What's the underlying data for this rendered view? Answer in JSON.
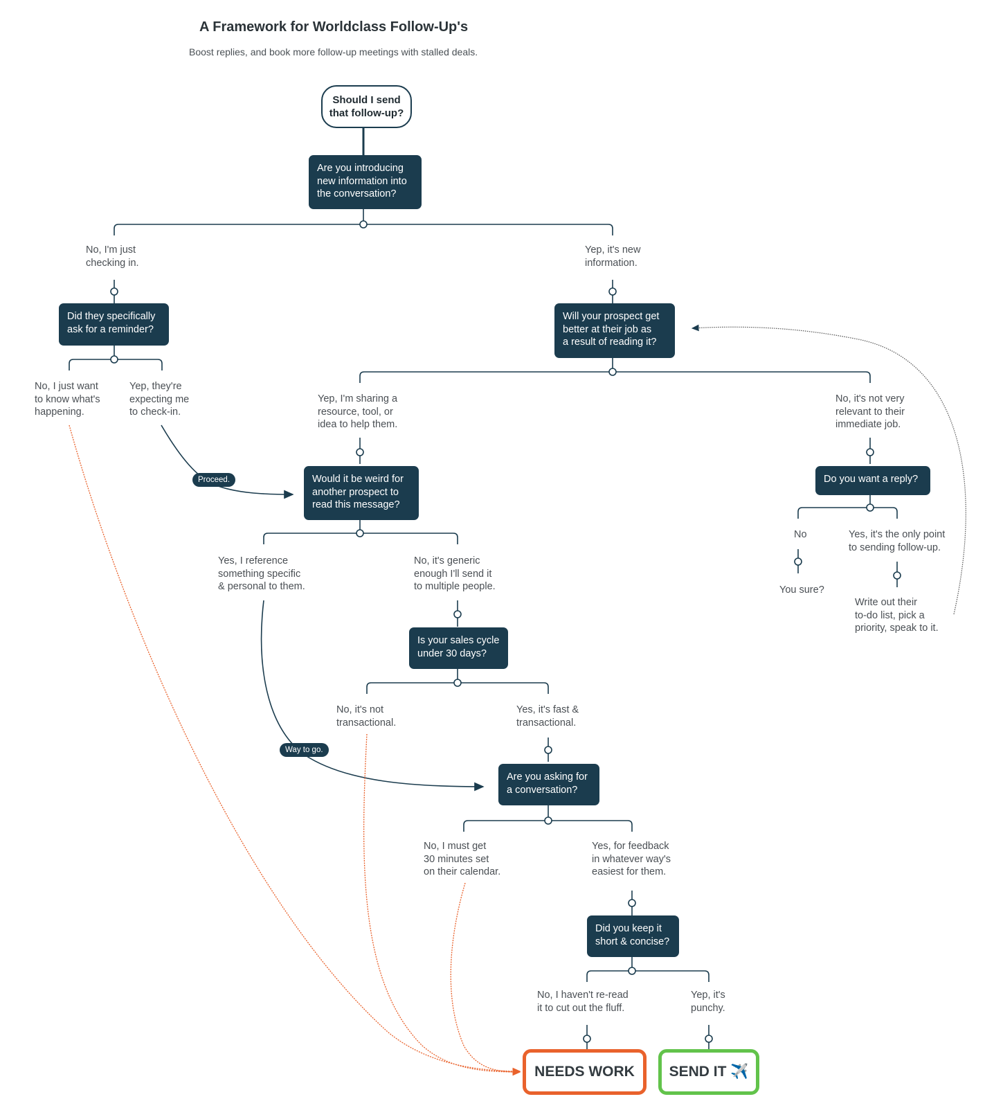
{
  "header": {
    "title": "A Framework for Worldclass Follow-Up's",
    "subtitle": "Boost replies, and book more follow-up meetings with stalled deals."
  },
  "start": {
    "text": "Should I send\nthat follow-up?"
  },
  "questions": {
    "q1": "Are you introducing\nnew information into\nthe conversation?",
    "q2": "Did they specifically\nask for a reminder?",
    "q3": "Will your prospect get\nbetter at their job as\na result of reading it?",
    "q4": "Would it be weird for\nanother prospect to\nread this message?",
    "q5": "Do you want a reply?",
    "q6": "Is your sales cycle\nunder 30 days?",
    "q7": "Are you asking for\na conversation?",
    "q8": "Did you keep it\nshort & concise?"
  },
  "answers": {
    "q1_no": "No, I'm just\nchecking in.",
    "q1_yes": "Yep, it's new\ninformation.",
    "q2_no": "No, I just want\nto know what's\nhappening.",
    "q2_yes": "Yep, they're\nexpecting me\nto check-in.",
    "q3_yes": "Yep, I'm sharing a\nresource, tool, or\nidea to help them.",
    "q3_no": "No, it's not very\nrelevant to their\nimmediate job.",
    "q4_yes": "Yes, I reference\nsomething specific\n& personal to them.",
    "q4_no": "No, it's generic\nenough I'll send it\nto multiple people.",
    "q5_no": "No",
    "q5_yes": "Yes, it's the only point\nto sending follow-up.",
    "q5_no_result": "You sure?",
    "q5_yes_result": "Write out their\nto-do list, pick a\npriority, speak to it.",
    "q6_no": "No, it's not\ntransactional.",
    "q6_yes": "Yes, it's fast &\ntransactional.",
    "q7_no": "No, I must get\n30 minutes set\non their calendar.",
    "q7_yes": "Yes, for feedback\nin whatever way's\neasiest for them.",
    "q8_no": "No, I haven't re-read\nit to cut out the fluff.",
    "q8_yes": "Yep, it's\npunchy."
  },
  "connector_labels": {
    "proceed": "Proceed.",
    "way_to_go": "Way to go."
  },
  "outcomes": {
    "needs_work": "NEEDS WORK",
    "send_it": "SEND IT ✈️"
  },
  "colors": {
    "node_fill": "#1b3c4e",
    "needs_work": "#e9622c",
    "send_it": "#62c34b",
    "dotted_red": "#e9622c",
    "dotted_gray": "#555555"
  }
}
